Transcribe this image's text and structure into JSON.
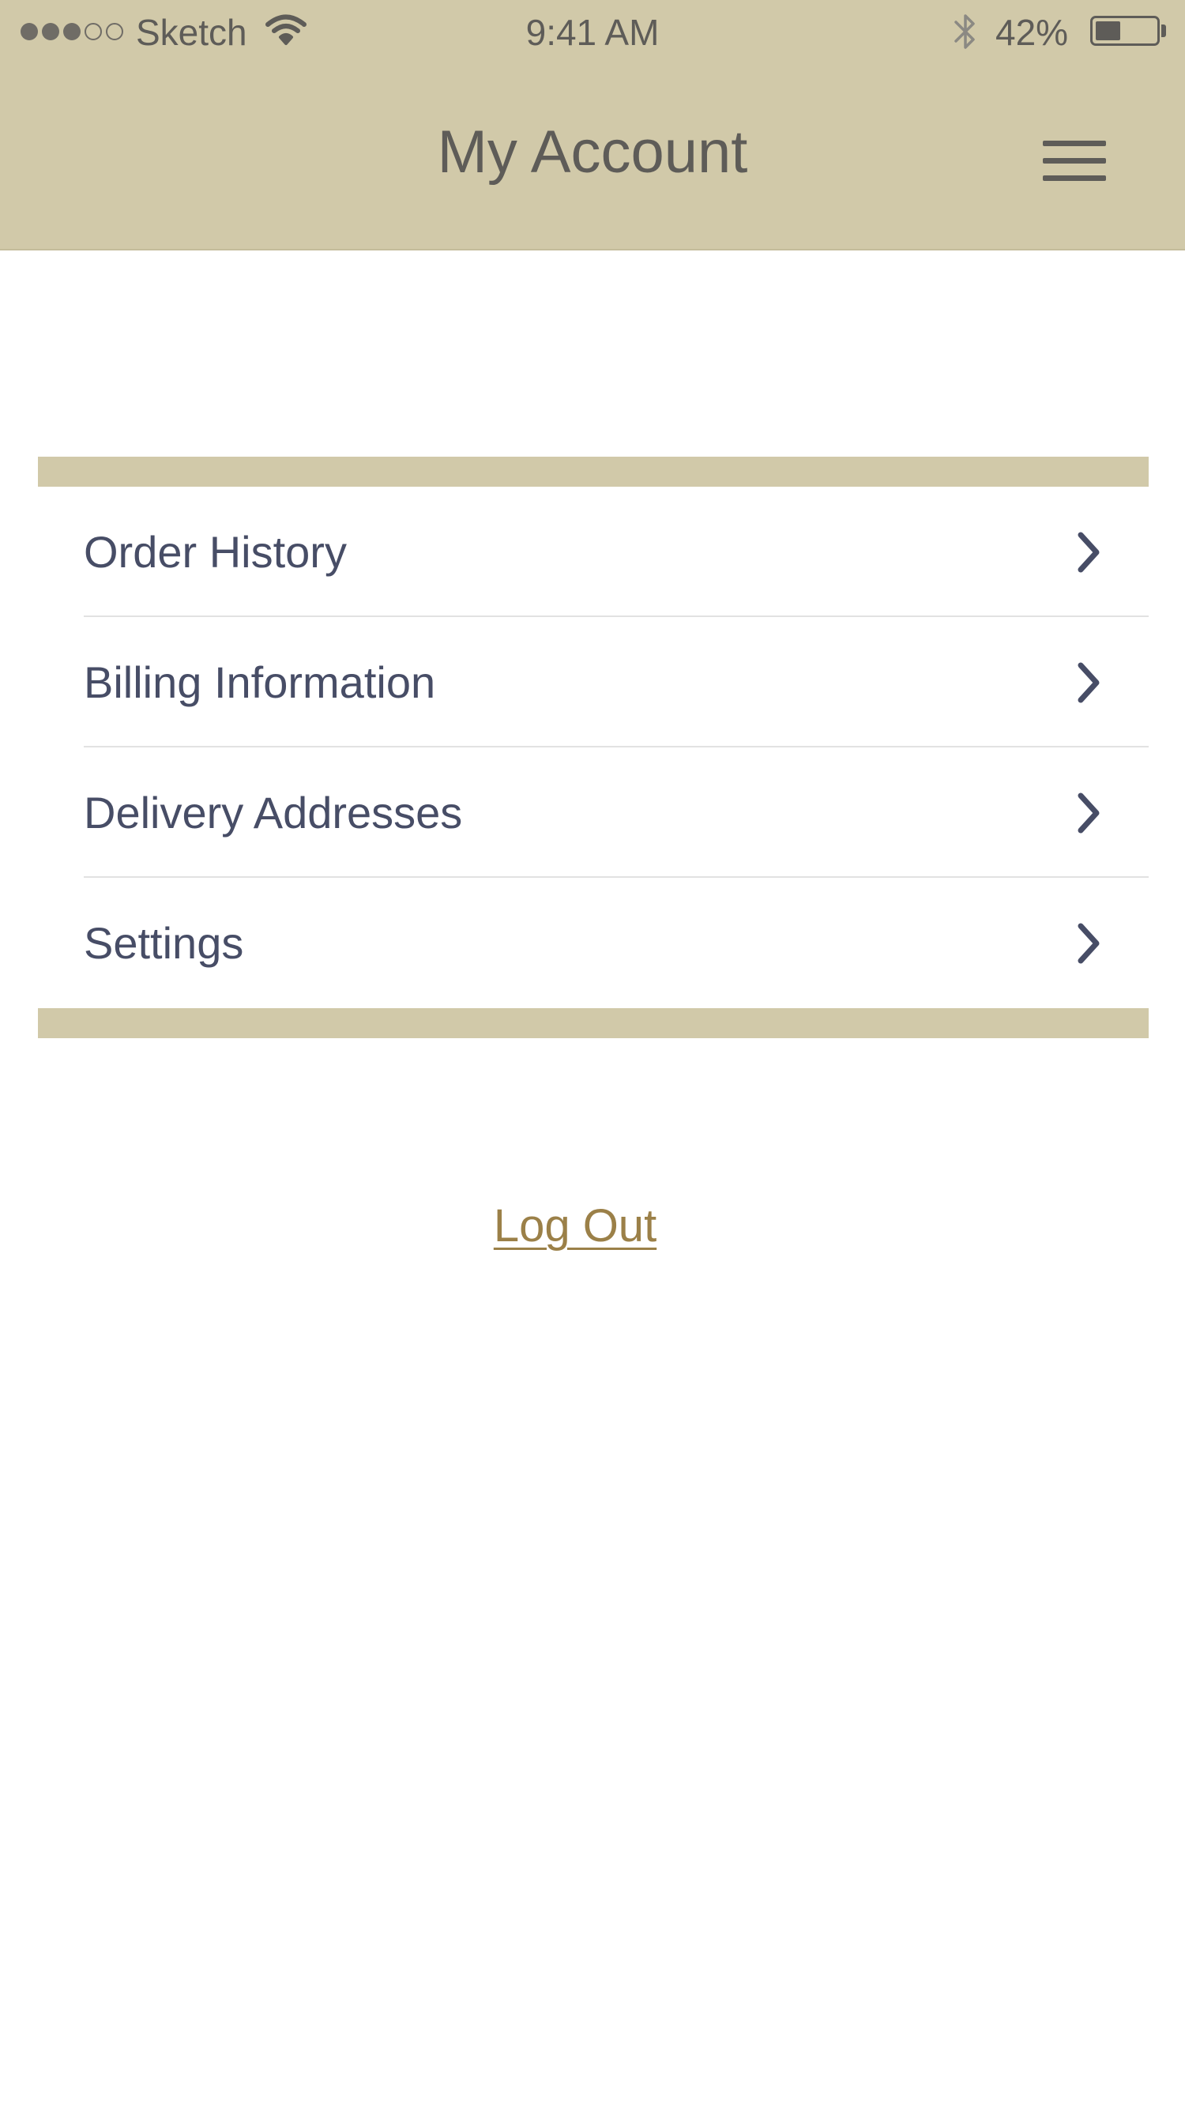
{
  "status_bar": {
    "signal_filled": 3,
    "signal_total": 5,
    "carrier": "Sketch",
    "time": "9:41 AM",
    "battery_percent_label": "42%",
    "battery_level": 0.42
  },
  "header": {
    "title": "My Account",
    "menu_icon": "hamburger-menu-icon"
  },
  "account_menu": {
    "items": [
      {
        "label": "Order History",
        "icon": "chevron-right-icon"
      },
      {
        "label": "Billing Information",
        "icon": "chevron-right-icon"
      },
      {
        "label": "Delivery Addresses",
        "icon": "chevron-right-icon"
      },
      {
        "label": "Settings",
        "icon": "chevron-right-icon"
      }
    ]
  },
  "logout": {
    "label": "Log Out"
  },
  "colors": {
    "header_background": "#d1c9a9",
    "header_text": "#5e5c58",
    "menu_text": "#474d66",
    "logout_link": "#9b8048",
    "divider": "#e2e2e2"
  }
}
